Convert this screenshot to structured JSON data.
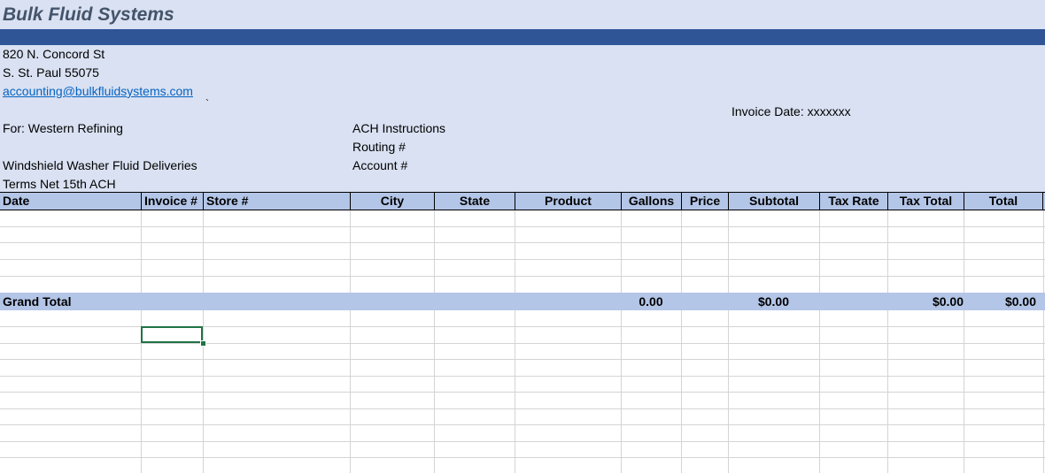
{
  "company": {
    "name": "Bulk Fluid Systems"
  },
  "address": {
    "street": "820 N. Concord St",
    "city": "S. St. Paul 55075",
    "email": "accounting@bulkfluidsystems.com",
    "tick": "`"
  },
  "invoice": {
    "date_label": "Invoice Date: xxxxxxx",
    "for": "For: Western Refining",
    "description": "Windshield Washer Fluid Deliveries",
    "terms": "Terms Net 15th ACH"
  },
  "ach": {
    "title": "ACH Instructions",
    "routing": "Routing #",
    "account": "Account #"
  },
  "table": {
    "headers": [
      "Date",
      "Invoice #",
      "Store #",
      "City",
      "State",
      "Product",
      "Gallons",
      "Price",
      "Subtotal",
      "Tax Rate",
      "Tax Total",
      "Total"
    ]
  },
  "grand_total": {
    "label": "Grand Total",
    "gallons": "0.00",
    "subtotal": "$0.00",
    "tax_total": "$0.00",
    "total": "$0.00"
  }
}
